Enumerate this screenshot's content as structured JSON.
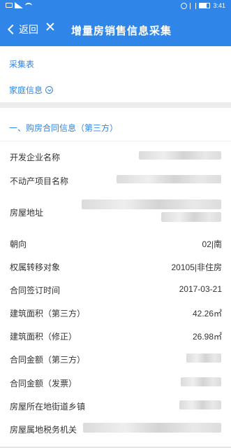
{
  "status_bar": {
    "time": "3:41"
  },
  "nav": {
    "back_label": "返回",
    "close_symbol": "✕",
    "title": "增量房销售信息采集"
  },
  "links": {
    "collection_form": "采集表",
    "family_info": "家庭信息"
  },
  "section": {
    "title": "一、购房合同信息（第三方）"
  },
  "fields": [
    {
      "label": "开发企业名称",
      "value": ""
    },
    {
      "label": "不动产项目名称",
      "value": ""
    },
    {
      "label": "房屋地址",
      "value": ""
    },
    {
      "label": "朝向",
      "value": "02|南"
    },
    {
      "label": "权属转移对象",
      "value": "20105|非住房"
    },
    {
      "label": "合同签订时间",
      "value": "2017-03-21"
    },
    {
      "label": "建筑面积（第三方）",
      "value": "42.26㎡"
    },
    {
      "label": "建筑面积（修正）",
      "value": "26.98㎡"
    },
    {
      "label": "合同金额（第三方）",
      "value": ""
    },
    {
      "label": "合同金额（发票）",
      "value": ""
    },
    {
      "label": "房屋所在地街道乡镇",
      "value": ""
    },
    {
      "label": "房屋属地税务机关",
      "value": ""
    }
  ],
  "colors": {
    "accent": "#2f86e8",
    "text": "#333333",
    "divider": "#ececec"
  }
}
